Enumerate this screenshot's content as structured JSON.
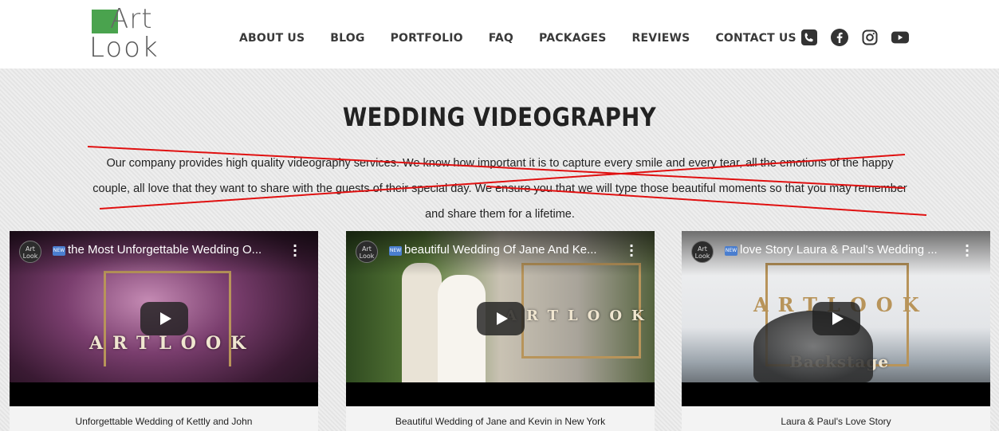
{
  "logo": {
    "line1": "Art",
    "line2": "Look"
  },
  "nav": [
    "ABOUT US",
    "BLOG",
    "PORTFOLIO",
    "FAQ",
    "PACKAGES",
    "REVIEWS",
    "CONTACT US"
  ],
  "social_icons": [
    "phone-icon",
    "facebook-icon",
    "instagram-icon",
    "youtube-icon"
  ],
  "main": {
    "title": "WEDDING VIDEOGRAPHY",
    "description": "Our company provides high quality videography services. We know how important it is to capture every smile and every tear, all the emotions of the happy couple, all love that they want to share with the guests of their special day. We ensure you that we will type those beautiful moments so that you may remember and share them for a lifetime.",
    "strike_color": "#e01010"
  },
  "videos": [
    {
      "title": "the Most Unforgettable Wedding O...",
      "caption": "Unforgettable Wedding of Kettly and John",
      "overlay": "ARTLOOK",
      "badge": "NEW",
      "channel": "Art Look"
    },
    {
      "title": "beautiful Wedding Of Jane And Ke...",
      "caption": "Beautiful Wedding of Jane and Kevin in New York",
      "overlay": "ARTLOOK",
      "badge": "NEW",
      "channel": "Art Look"
    },
    {
      "title": "love Story Laura & Paul's Wedding ...",
      "caption": "Laura & Paul's Love Story",
      "overlay": "ARTLOOK",
      "overlay2": "Backstage",
      "badge": "NEW",
      "channel": "Art Look"
    }
  ],
  "colors": {
    "brand_green": "#4aa34e",
    "background": "#e9e9e9",
    "nav_text": "#3a3a3a"
  }
}
